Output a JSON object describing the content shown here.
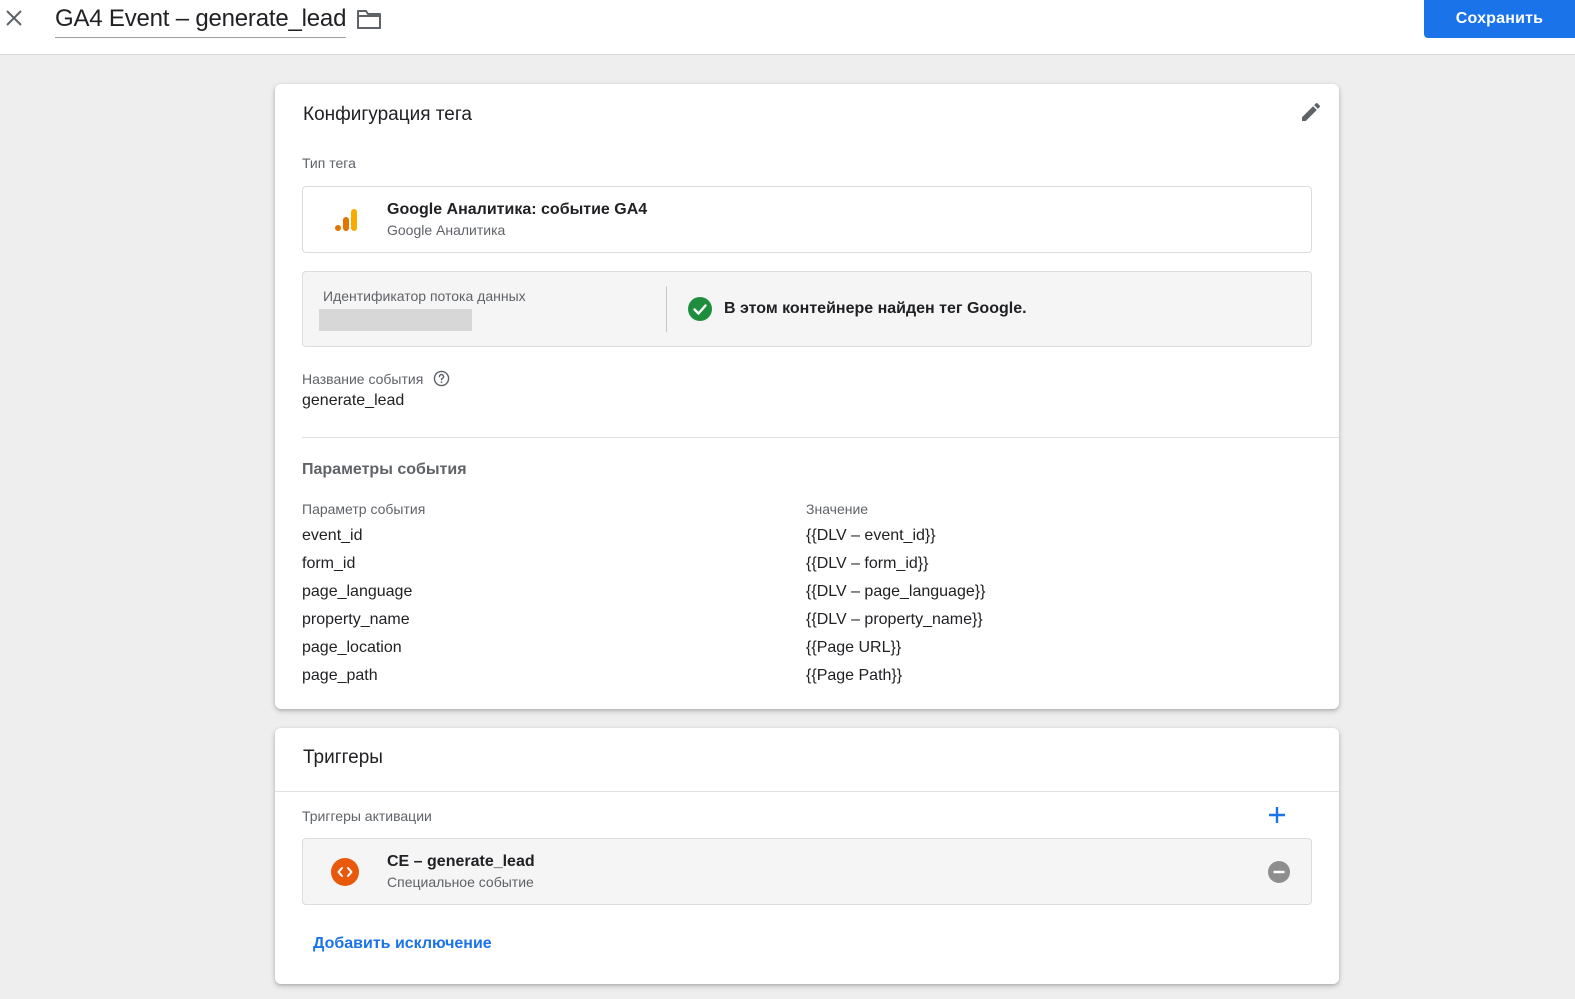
{
  "header": {
    "title": "GA4 Event – generate_lead",
    "save_label": "Сохранить",
    "accent_color": "#1a73e8"
  },
  "config": {
    "title": "Конфигурация тега",
    "tag_type_label": "Тип тега",
    "tag_type": {
      "name": "Google Аналитика: событие GA4",
      "subtitle": "Google Аналитика",
      "icon": "google-analytics-icon"
    },
    "stream": {
      "label": "Идентификатор потока данных",
      "status": "В этом контейнере найден тег Google."
    },
    "event_name_label": "Название события",
    "event_name_value": "generate_lead",
    "params_title": "Параметры события",
    "params_header": {
      "name": "Параметр события",
      "value": "Значение"
    },
    "params": [
      {
        "name": "event_id",
        "value": "{{DLV – event_id}}"
      },
      {
        "name": "form_id",
        "value": "{{DLV – form_id}}"
      },
      {
        "name": "page_language",
        "value": "{{DLV – page_language}}"
      },
      {
        "name": "property_name",
        "value": "{{DLV – property_name}}"
      },
      {
        "name": "page_location",
        "value": "{{Page URL}}"
      },
      {
        "name": "page_path",
        "value": "{{Page Path}}"
      }
    ]
  },
  "triggers": {
    "title": "Триггеры",
    "firing_label": "Триггеры активации",
    "items": [
      {
        "name": "CE – generate_lead",
        "type": "Специальное событие",
        "icon": "custom-event-icon"
      }
    ],
    "add_exception_label": "Добавить исключение"
  }
}
